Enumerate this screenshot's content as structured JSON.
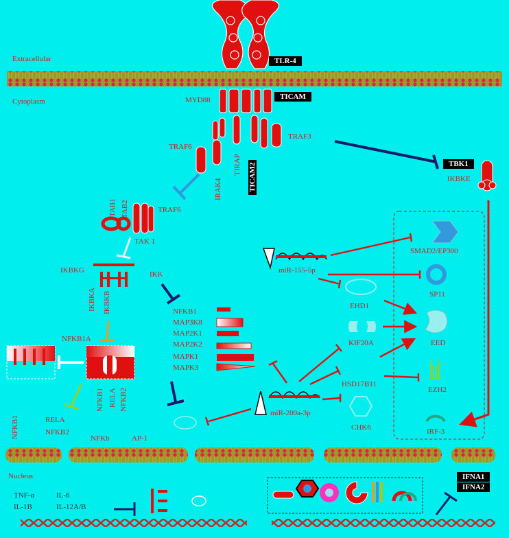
{
  "compartments": {
    "extracellular": "Extracellular",
    "cytoplasm": "Cytoplasm",
    "nucleus": "Nucleus"
  },
  "receptors": {
    "tlr4": "TLR-4",
    "ticam": "TICAM",
    "myd88": "MYD88"
  },
  "adaptors": {
    "traf3": "TRAF3",
    "traf6_top": "TRAF6",
    "irak4": "IRAK4",
    "tirap": "TIRAP",
    "ticam2": "TICAM2",
    "tbk1": "TBK1",
    "ikbke": "IKBKE"
  },
  "tak_complex": {
    "tab1": "TAB1",
    "tab2": "TAB2",
    "traf6": "TRAF6",
    "tak1": "TAK 1"
  },
  "ikk_complex": {
    "ikbkg": "IKBKG",
    "ikbka": "IKBKA",
    "ikbkb": "IKBKB",
    "ikk": "IKK",
    "nfkb1a": "NFKB1A"
  },
  "nfkb_targets": {
    "nfkb1": "NFKB1",
    "rela": "RELA",
    "nfkb2": "NFKB2"
  },
  "mapk_list": [
    "NFKB1",
    "MAP3K8",
    "MAP2K1",
    "MAP2K2",
    "MAPK1",
    "MAPK3"
  ],
  "nuclear_left": {
    "nfkb1": "NFKB1",
    "rela": "RELA",
    "nfkb2": "NFKB2",
    "nfkb_label": "NFKb",
    "ap1_label": "AP-1"
  },
  "mirnas": {
    "mir_a": "miR-155-5p",
    "mir_b": "miR-200a-3p"
  },
  "mirna_targets": {
    "ehd1": "EHD1",
    "kif20a": "KIF20A",
    "hsd17b11": "HSD17B11",
    "chk6": "CHK6"
  },
  "boxed_targets": {
    "smad": "SMAD2/EP300",
    "sp11": "SP11",
    "eed": "EED",
    "ezh2": "EZH2",
    "irf3": "IRF-3"
  },
  "cytokines": {
    "tnfa": "TNF-α",
    "il6": "IL-6",
    "il1b": "IL-1B",
    "il12": "IL-12A/B"
  },
  "interferons": {
    "ifna1": "IFNA1",
    "ifna2": "IFNA2"
  },
  "colors": {
    "background": "#00eeee",
    "protein_red": "#e01010",
    "membrane_olive": "#8a8a2a",
    "inhibit_navy": "#1a1a6a",
    "inhibit_blue": "#3399dd"
  }
}
